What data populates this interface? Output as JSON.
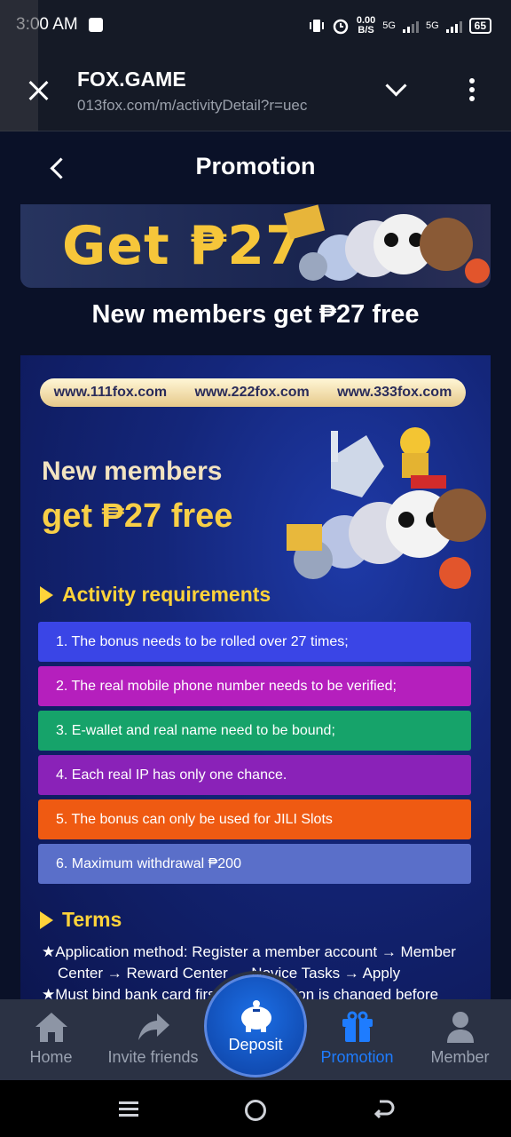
{
  "status_bar": {
    "time": "3:00 AM",
    "speed_value": "0.00",
    "speed_unit": "B/S",
    "net1": "5G",
    "net2": "5G",
    "battery": "65"
  },
  "browser": {
    "title": "FOX.GAME",
    "url": "013fox.com/m/activityDetail?r=uec"
  },
  "header": {
    "title": "Promotion"
  },
  "banner": {
    "text": "Get ₱27"
  },
  "promotion": {
    "title": "New members get ₱27 free"
  },
  "poster": {
    "domains": [
      "www.111fox.com",
      "www.222fox.com",
      "www.333fox.com"
    ],
    "headline_line1": "New members",
    "headline_line2": "get ₱27 free",
    "requirements_title": "Activity requirements",
    "requirements": [
      {
        "text": "1. The bonus needs to be rolled over 27 times;",
        "color": "#3a45e6"
      },
      {
        "text": "2. The real mobile phone number needs to be verified;",
        "color": "#b51fbd"
      },
      {
        "text": "3. E-wallet and real name need to be bound;",
        "color": "#16a36a"
      },
      {
        "text": "4. Each real IP has only one chance.",
        "color": "#8a22b8"
      },
      {
        "text": "5. The bonus can only be used for JILI Slots",
        "color": "#ef5a12"
      },
      {
        "text": "6. Maximum withdrawal ₱200",
        "color": "#5a6fc9"
      }
    ],
    "terms_title": "Terms",
    "terms": [
      "★Application method: Register a member account → Member Center → Reward Center → Novice Tasks → Apply",
      "★Must bind bank card first, if information is changed before"
    ]
  },
  "bottom_nav": {
    "home": "Home",
    "invite": "Invite friends",
    "deposit": "Deposit",
    "promotion": "Promotion",
    "member": "Member"
  },
  "colors": {
    "accent": "#1e7cff",
    "gold": "#ffd33a",
    "background": "#0a1128"
  }
}
